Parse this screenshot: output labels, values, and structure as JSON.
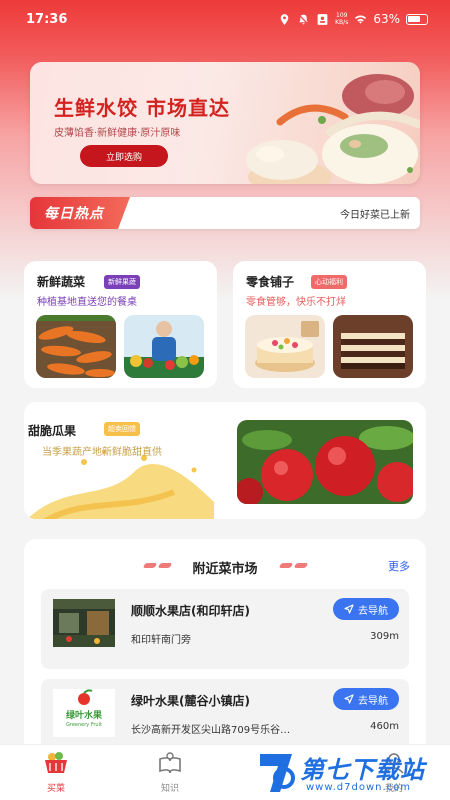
{
  "status_bar": {
    "time": "17:36",
    "net_speed": "109",
    "net_unit": "KB/s",
    "battery": "63%",
    "battery_level": 0.63
  },
  "banner": {
    "title": "生鲜水饺 市场直达",
    "subtitle": "皮薄馅香·新鲜健康·原汁原味",
    "button": "立即选购"
  },
  "daily_hot": {
    "tag": "每日热点",
    "text": "今日好菜已上新"
  },
  "categories": [
    {
      "title": "新鲜蔬菜",
      "badge": "新鲜果蔬",
      "desc": "种植基地直送您的餐桌",
      "badge_color": "#7b3fb8",
      "desc_color": "#7b3fb8"
    },
    {
      "title": "零食铺子",
      "badge": "心动福利",
      "desc": "零食管够，快乐不打烊",
      "badge_color": "#f06a6a",
      "desc_color": "#e85c5c"
    },
    {
      "title": "甜脆瓜果",
      "badge": "超卖回馈",
      "desc": "当季果蔬产地新鲜脆甜直供",
      "badge_color": "#f6c04a",
      "desc_color": "#c7a24a"
    }
  ],
  "market": {
    "title": "附近菜市场",
    "more": "更多",
    "shops": [
      {
        "name": "顺顺水果店(和印轩店)",
        "address": "和印轩南门旁",
        "distance": "309m",
        "nav": "去导航"
      },
      {
        "name": "绿叶水果(麓谷小镇店)",
        "address": "长沙高新开发区尖山路709号乐谷…",
        "distance": "460m",
        "nav": "去导航",
        "logo_text": "绿叶水果",
        "logo_sub": "Greenery Fruit"
      }
    ]
  },
  "tabs": [
    {
      "label": "买菜",
      "active": true
    },
    {
      "label": "知识",
      "active": false
    },
    {
      "label": "我的",
      "active": false
    }
  ],
  "watermark": {
    "title": "第七下载站",
    "url": "www.d7down.com"
  },
  "colors": {
    "primary_red": "#e5363a",
    "nav_blue": "#3a74f0",
    "more_blue": "#2f5ef5",
    "active_tab": "#e5363a"
  }
}
